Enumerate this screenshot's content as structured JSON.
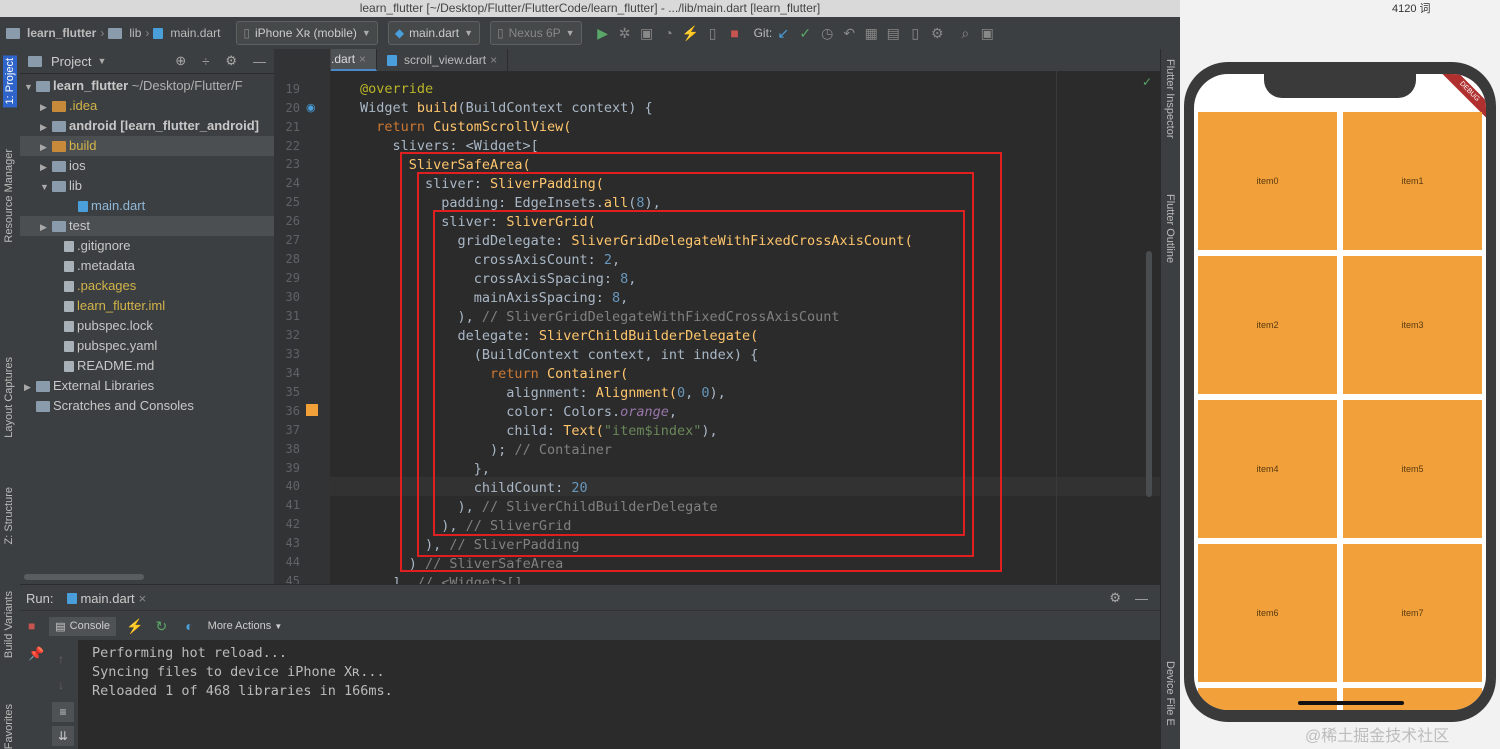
{
  "window": {
    "title": "learn_flutter [~/Desktop/Flutter/FlutterCode/learn_flutter] - .../lib/main.dart [learn_flutter]",
    "word_count": "4120 词"
  },
  "toolbar": {
    "breadcrumb_project": "learn_flutter",
    "breadcrumb_lib": "lib",
    "breadcrumb_file": "main.dart",
    "device": "iPhone Xʀ (mobile)",
    "run_config": "main.dart",
    "emulator": "Nexus 6P",
    "git_label": "Git:"
  },
  "left_strip": [
    "1: Project",
    "Resource Manager",
    "Layout Captures",
    "Z: Structure",
    "Build Variants",
    "Favorites"
  ],
  "right_strip": [
    "Flutter Inspector",
    "Flutter Outline",
    "Device File E"
  ],
  "project_panel": {
    "title": "Project",
    "tree": [
      {
        "label": "learn_flutter",
        "hint": "~/Desktop/Flutter/F"
      },
      {
        "label": ".idea"
      },
      {
        "label": "android [learn_flutter_android]"
      },
      {
        "label": "build"
      },
      {
        "label": "ios"
      },
      {
        "label": "lib"
      },
      {
        "label": "main.dart"
      },
      {
        "label": "test"
      },
      {
        "label": ".gitignore"
      },
      {
        "label": ".metadata"
      },
      {
        "label": ".packages"
      },
      {
        "label": "learn_flutter.iml"
      },
      {
        "label": "pubspec.lock"
      },
      {
        "label": "pubspec.yaml"
      },
      {
        "label": "README.md"
      },
      {
        "label": "External Libraries"
      },
      {
        "label": "Scratches and Consoles"
      }
    ]
  },
  "editor": {
    "tabs": [
      "main.dart",
      "scroll_view.dart"
    ],
    "line_numbers": [
      "19",
      "20",
      "21",
      "22",
      "23",
      "24",
      "25",
      "26",
      "27",
      "28",
      "29",
      "30",
      "31",
      "32",
      "33",
      "34",
      "35",
      "36",
      "37",
      "38",
      "39",
      "40",
      "41",
      "42",
      "43",
      "44",
      "45"
    ],
    "code": {
      "l19": "@override",
      "l20a": "Widget ",
      "l20b": "build",
      "l20c": "(BuildContext context) {",
      "l21a": "  return ",
      "l21b": "CustomScrollView(",
      "l22": "    slivers: <Widget>[",
      "l23": "      SliverSafeArea(",
      "l24a": "        sliver: ",
      "l24b": "SliverPadding(",
      "l25a": "          padding: EdgeInsets.",
      "l25b": "all",
      "l25c": "(",
      "l25d": "8",
      "l25e": "),",
      "l26a": "          sliver: ",
      "l26b": "SliverGrid(",
      "l27a": "            gridDelegate: ",
      "l27b": "SliverGridDelegateWithFixedCrossAxisCount(",
      "l28a": "              crossAxisCount: ",
      "l28b": "2",
      "l28c": ",",
      "l29a": "              crossAxisSpacing: ",
      "l29b": "8",
      "l29c": ",",
      "l30a": "              mainAxisSpacing: ",
      "l30b": "8",
      "l30c": ",",
      "l31a": "            ), ",
      "l31b": "// SliverGridDelegateWithFixedCrossAxisCount",
      "l32a": "            delegate: ",
      "l32b": "SliverChildBuilderDelegate(",
      "l33": "              (BuildContext context, int index) {",
      "l34a": "                return ",
      "l34b": "Container(",
      "l35a": "                  alignment: ",
      "l35b": "Alignment(",
      "l35c": "0",
      "l35d": ", ",
      "l35e": "0",
      "l35f": "),",
      "l36a": "                  color: Colors.",
      "l36b": "orange",
      "l36c": ",",
      "l37a": "                  child: ",
      "l37b": "Text(",
      "l37c": "\"item$index\"",
      "l37d": "),",
      "l38a": "                ); ",
      "l38b": "// Container",
      "l39": "              },",
      "l40a": "              childCount: ",
      "l40b": "20",
      "l41a": "            ), ",
      "l41b": "// SliverChildBuilderDelegate",
      "l42a": "          ), ",
      "l42b": "// SliverGrid",
      "l43a": "        ), ",
      "l43b": "// SliverPadding",
      "l44a": "      ) ",
      "l44b": "// SliverSafeArea",
      "l45a": "    ], ",
      "l45b": "// <Widget>[]"
    }
  },
  "run_panel": {
    "label": "Run:",
    "tab": "main.dart",
    "console_tab": "Console",
    "more_actions": "More Actions",
    "lines": [
      "Performing hot reload...",
      "Syncing files to device iPhone Xʀ...",
      "Reloaded 1 of 468 libraries in 166ms."
    ]
  },
  "phone": {
    "debug_banner": "DEBUG",
    "items": [
      "item0",
      "item1",
      "item2",
      "item3",
      "item4",
      "item5",
      "item6",
      "item7"
    ],
    "item_color": "#F2A03A"
  },
  "watermark": "@稀土掘金技术社区",
  "colors": {
    "keyword": "#cc7832",
    "function": "#ffc66d",
    "number": "#6897bb",
    "comment": "#808080",
    "string": "#6a8759",
    "highlight_box": "#e02020"
  }
}
